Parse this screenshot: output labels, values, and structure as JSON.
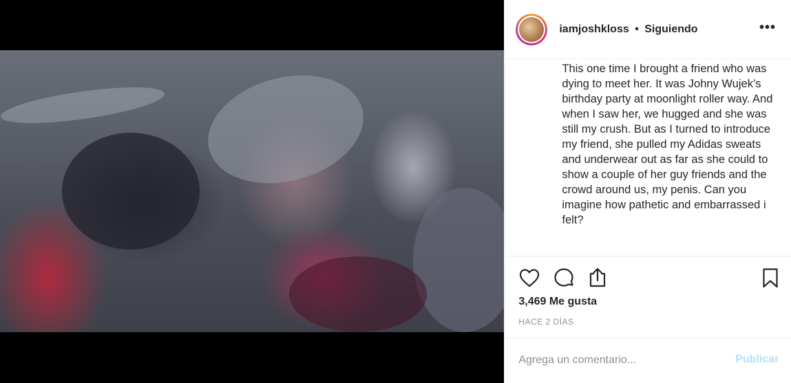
{
  "post": {
    "username": "iamjoshkloss",
    "separator": "•",
    "follow_status": "Siguiendo",
    "more_label": "•••",
    "caption": "This one time I brought a friend who was dying to meet her. It was Johny Wujek’s birthday party at moonlight roller way. And when I saw her, we hugged and she was still my crush. But as I turned to introduce my friend, she pulled my Adidas sweats and underwear out as far as she could to show a couple of her guy friends and the crowd around us, my penis. Can you imagine how pathetic and embarrassed i felt?",
    "likes": "3,469 Me gusta",
    "date": "HACE 2 DÍAS"
  },
  "icons": {
    "like": "heart-icon",
    "comment": "comment-icon",
    "share": "share-icon",
    "save": "bookmark-icon",
    "more": "more-icon"
  },
  "comment_box": {
    "placeholder": "Agrega un comentario...",
    "publish_label": "Publicar"
  },
  "colors": {
    "text": "#262626",
    "muted": "#8e8e8e",
    "publish_disabled": "#b2dffc",
    "media_bg": "#000000"
  }
}
